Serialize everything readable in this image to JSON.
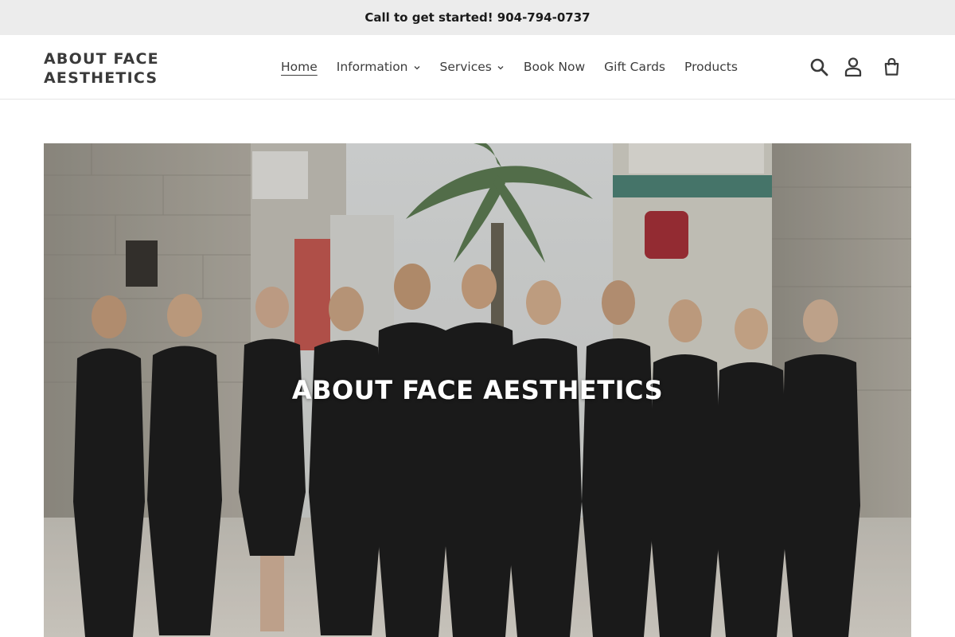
{
  "announcement": {
    "text": "Call to get started! 904-794-0737"
  },
  "header": {
    "logo_line1": "ABOUT FACE",
    "logo_line2": "AESTHETICS",
    "nav": [
      {
        "label": "Home",
        "active": true,
        "has_dropdown": false
      },
      {
        "label": "Information",
        "active": false,
        "has_dropdown": true
      },
      {
        "label": "Services",
        "active": false,
        "has_dropdown": true
      },
      {
        "label": "Book Now",
        "active": false,
        "has_dropdown": false
      },
      {
        "label": "Gift Cards",
        "active": false,
        "has_dropdown": false
      },
      {
        "label": "Products",
        "active": false,
        "has_dropdown": false
      }
    ],
    "icons": [
      "search-icon",
      "account-icon",
      "cart-icon"
    ]
  },
  "hero": {
    "title": "ABOUT FACE AESTHETICS",
    "image": "team-photo",
    "uniform_color": "#1e1e1e"
  }
}
